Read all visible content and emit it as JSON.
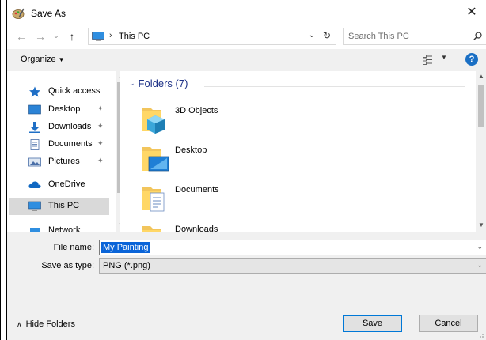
{
  "window": {
    "title": "Save As",
    "close_glyph": "✕"
  },
  "nav": {
    "back_glyph": "←",
    "forward_glyph": "→",
    "recent_glyph": "⌄",
    "up_glyph": "↑",
    "address_chevron": "›",
    "address_text": "This PC",
    "address_dropdown": "⌄",
    "refresh_glyph": "↻",
    "search_placeholder": "Search This PC"
  },
  "command_bar": {
    "organize_label": "Organize",
    "organize_caret": "▼",
    "view_caret": "▼",
    "help_label": "?"
  },
  "sidebar": {
    "items": [
      {
        "label": "Quick access",
        "icon": "star-icon",
        "pinned": false
      },
      {
        "label": "Desktop",
        "icon": "desktop-icon",
        "pinned": true
      },
      {
        "label": "Downloads",
        "icon": "download-icon",
        "pinned": true
      },
      {
        "label": "Documents",
        "icon": "documents-icon",
        "pinned": true
      },
      {
        "label": "Pictures",
        "icon": "pictures-icon",
        "pinned": true
      },
      {
        "label": "OneDrive",
        "icon": "cloud-icon",
        "pinned": false
      },
      {
        "label": "This PC",
        "icon": "computer-icon",
        "pinned": false,
        "selected": true
      },
      {
        "label": "Network",
        "icon": "network-icon",
        "pinned": false
      }
    ],
    "pin_glyph": "📌",
    "scroll_up": "▲",
    "scroll_down": "▼"
  },
  "main": {
    "group_chevron": "⌄",
    "group_title": "Folders (7)",
    "folders": [
      {
        "name": "3D Objects",
        "icon": "3d-objects-folder-icon"
      },
      {
        "name": "Desktop",
        "icon": "desktop-folder-icon"
      },
      {
        "name": "Documents",
        "icon": "documents-folder-icon"
      },
      {
        "name": "Downloads",
        "icon": "downloads-folder-icon"
      }
    ],
    "scroll_up": "▲",
    "scroll_down": "▼"
  },
  "form": {
    "file_name_label": "File name:",
    "file_name_value": "My Painting",
    "save_type_label": "Save as type:",
    "save_type_value": "PNG (*.png)",
    "dropdown_glyph": "⌄"
  },
  "footer": {
    "hide_folders_caret": "∧",
    "hide_folders_label": "Hide Folders",
    "save_label": "Save",
    "cancel_label": "Cancel"
  },
  "colors": {
    "accent": "#0078d7",
    "group_title": "#1e3287",
    "selection": "#0a64d8",
    "panel": "#f0f0f0"
  }
}
